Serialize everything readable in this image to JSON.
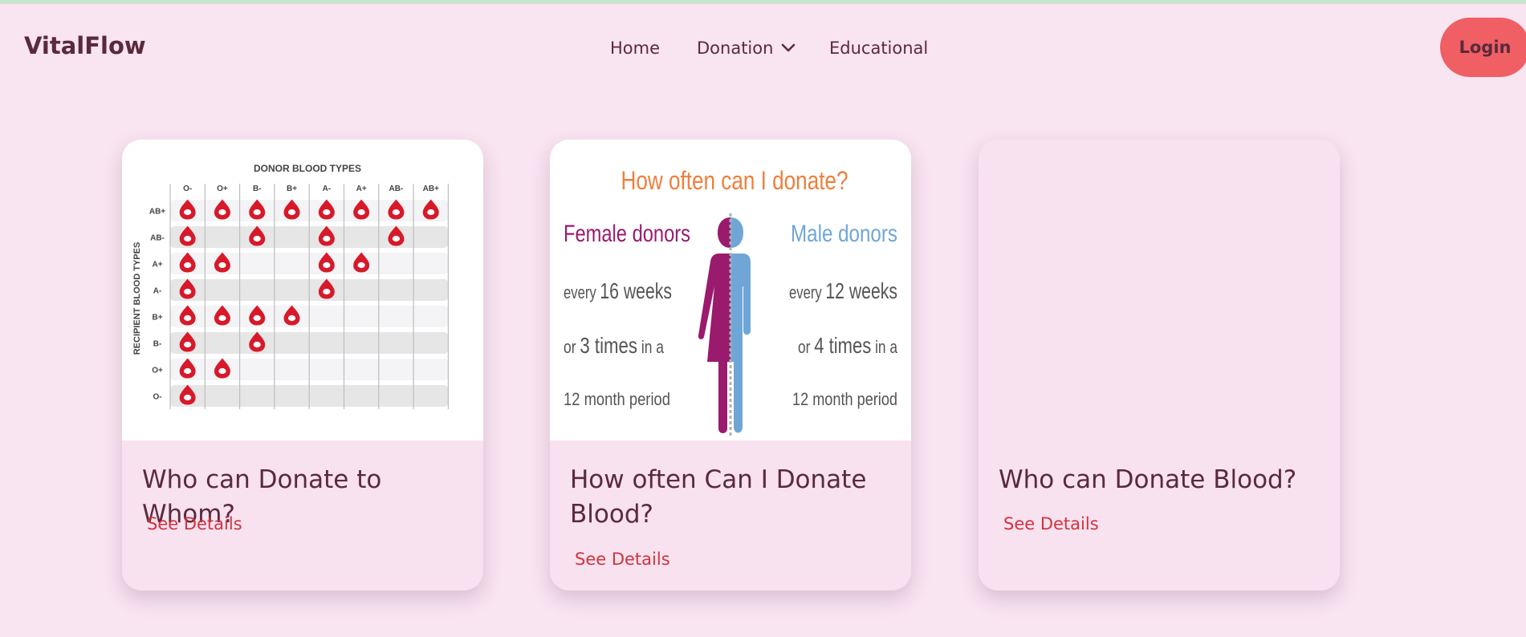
{
  "app": {
    "logo": "VitalFlow"
  },
  "nav": {
    "items": [
      {
        "label": "Home"
      },
      {
        "label": "Donation"
      },
      {
        "label": "Educational"
      }
    ],
    "login": "Login"
  },
  "cards": [
    {
      "title": "Who can Donate to Whom?",
      "link": "See Details"
    },
    {
      "title": "How often Can I Donate Blood?",
      "link": "See Details"
    },
    {
      "title": "Who can Donate Blood?",
      "link": "See Details"
    }
  ],
  "chart1": {
    "title": "DONOR BLOOD TYPES",
    "ylabel": "RECIPIENT BLOOD TYPES",
    "donors": [
      "O-",
      "O+",
      "B-",
      "B+",
      "A-",
      "A+",
      "AB-",
      "AB+"
    ],
    "recipients": [
      "AB+",
      "AB-",
      "A+",
      "A-",
      "B+",
      "B-",
      "O+",
      "O-"
    ],
    "compatible": [
      [
        1,
        1,
        1,
        1,
        1,
        1,
        1,
        1
      ],
      [
        1,
        0,
        1,
        0,
        1,
        0,
        1,
        0
      ],
      [
        1,
        1,
        0,
        0,
        1,
        1,
        0,
        0
      ],
      [
        1,
        0,
        0,
        0,
        1,
        0,
        0,
        0
      ],
      [
        1,
        1,
        1,
        1,
        0,
        0,
        0,
        0
      ],
      [
        1,
        0,
        1,
        0,
        0,
        0,
        0,
        0
      ],
      [
        1,
        1,
        0,
        0,
        0,
        0,
        0,
        0
      ],
      [
        1,
        0,
        0,
        0,
        0,
        0,
        0,
        0
      ]
    ],
    "drop_color": "#d7192a"
  },
  "infographic": {
    "title": "How often can I donate?",
    "female_label": "Female donors",
    "male_label": "Male donors",
    "female_lines": [
      {
        "small": "every ",
        "big": "16 weeks",
        "tail": ""
      },
      {
        "small": "or ",
        "big": "3 times",
        "tail": " in a"
      },
      {
        "small": "12 month period",
        "big": "",
        "tail": ""
      }
    ],
    "male_lines": [
      {
        "small": "every ",
        "big": "12 weeks",
        "tail": ""
      },
      {
        "small": "or ",
        "big": "4 times",
        "tail": " in a"
      },
      {
        "small": "12 month period",
        "big": "",
        "tail": ""
      }
    ],
    "colors": {
      "title": "#f07f3c",
      "female": "#9a1a6e",
      "male": "#6fa6d6",
      "text": "#555555"
    }
  },
  "colors": {
    "background": "#f9e4f1",
    "accent": "#ef5f64",
    "link": "#d0343f",
    "text": "#5a2a3c"
  },
  "icons": {
    "dropdown": "chevron-down-icon",
    "drop": "blood-drop-icon"
  }
}
